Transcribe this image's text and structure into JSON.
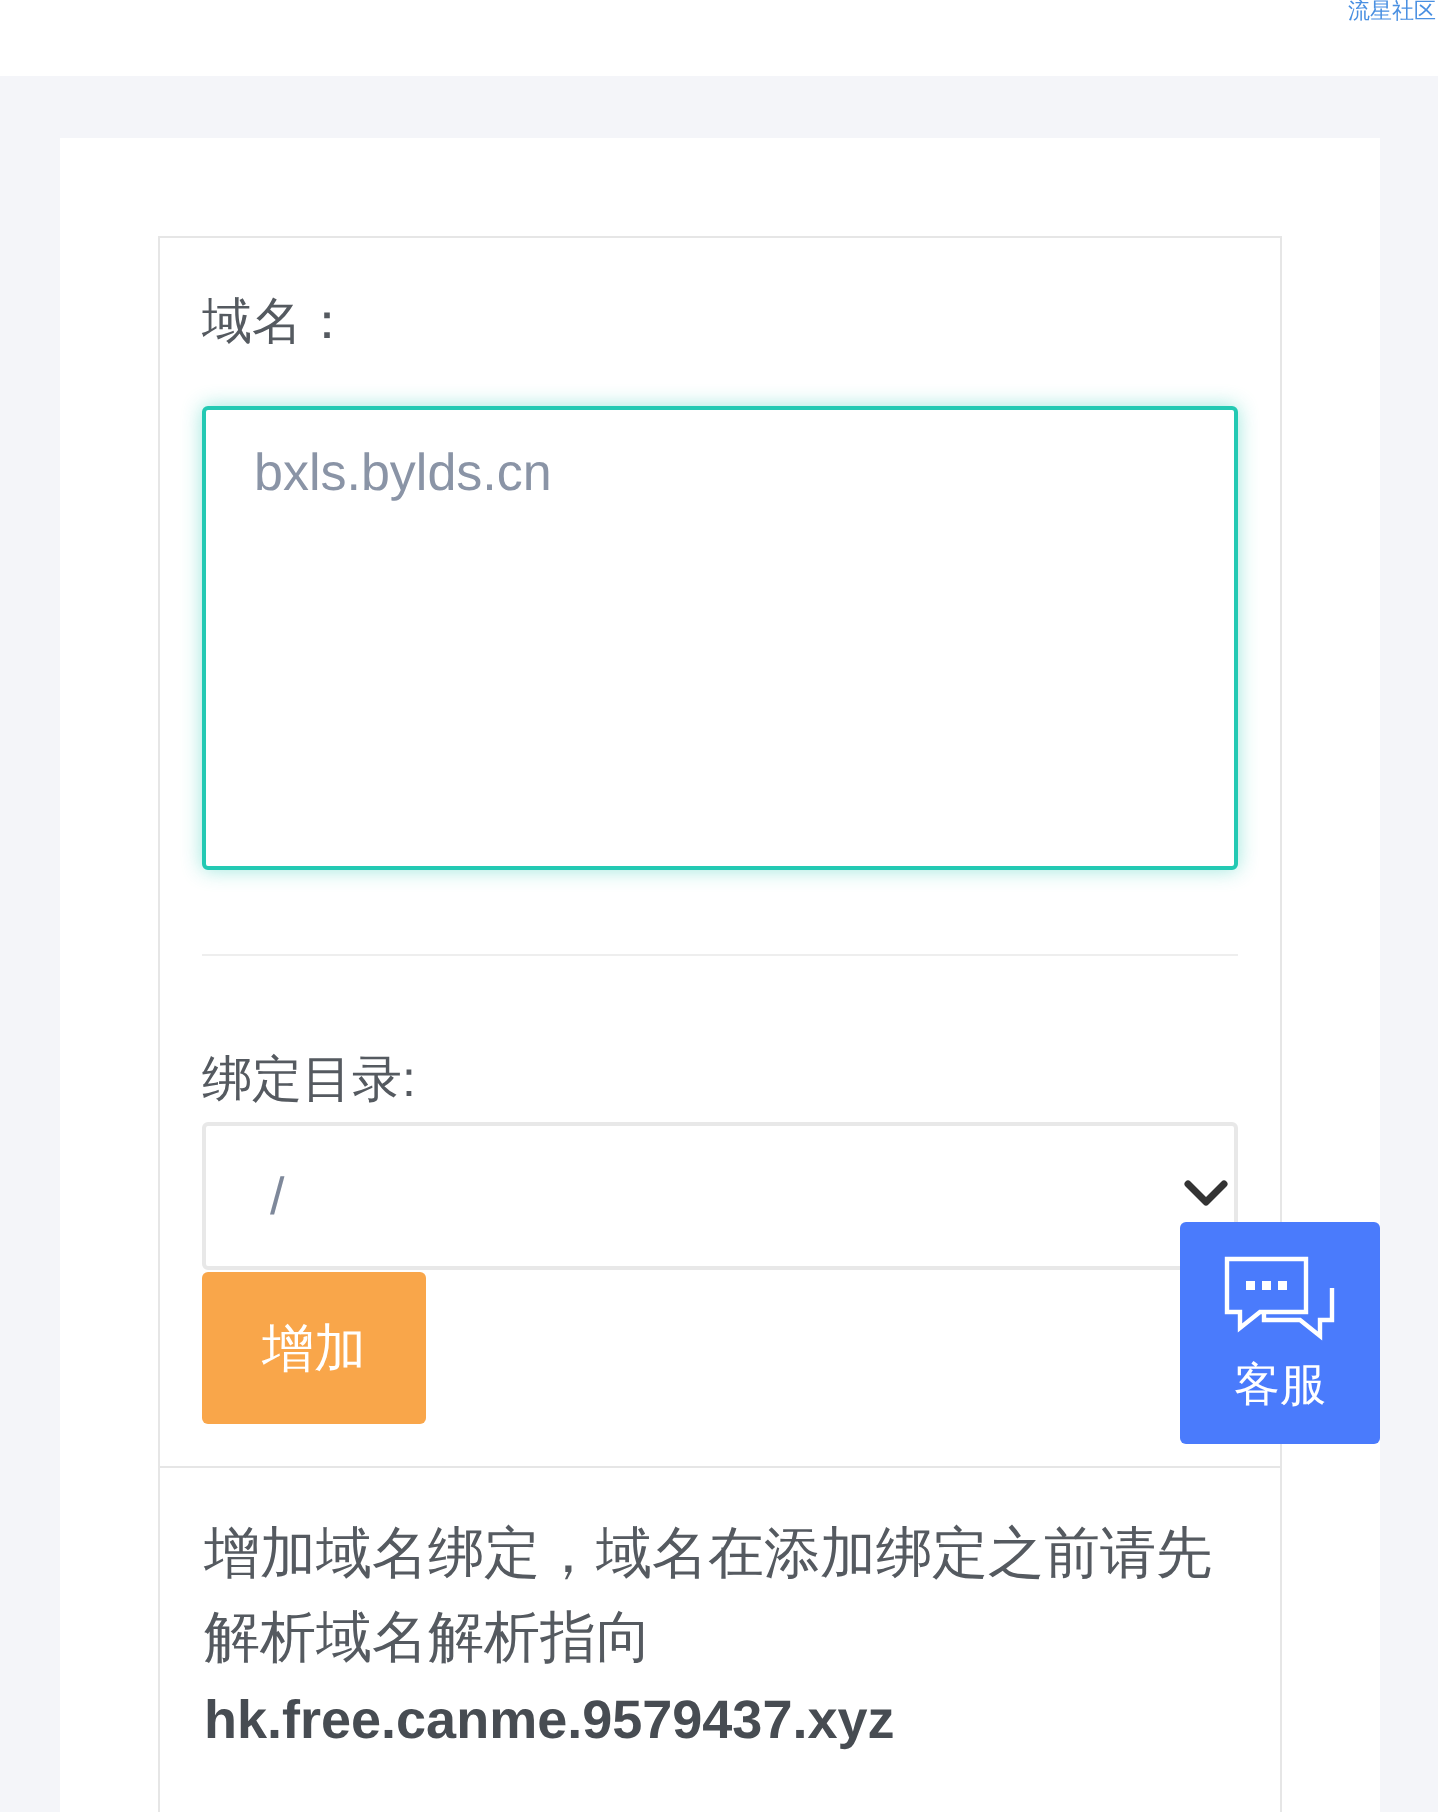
{
  "header": {
    "link": "流星社区"
  },
  "domain_form": {
    "domain_label": "域名：",
    "domain_field": {
      "placeholder": "bxls.bylds.cn",
      "focused": true
    },
    "directory_label": "绑定目录:",
    "directory_select": {
      "value": "/"
    },
    "add_button": "增加"
  },
  "notice": {
    "text": "增加域名绑定，域名在添加绑定之前请先解析域名解析指向",
    "domain": "hk.free.canme.9579437.xyz"
  },
  "support_button": {
    "label": "客服"
  }
}
